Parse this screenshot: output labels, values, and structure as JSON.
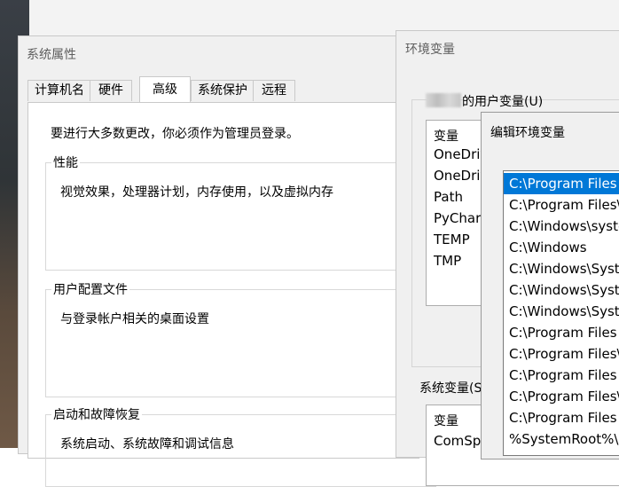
{
  "system_properties": {
    "title": "系统属性",
    "tabs": [
      {
        "label": "计算机名"
      },
      {
        "label": "硬件"
      },
      {
        "label": "高级"
      },
      {
        "label": "系统保护"
      },
      {
        "label": "远程"
      }
    ],
    "active_tab": "高级",
    "notice": "要进行大多数更改，你必须作为管理员登录。",
    "groups": [
      {
        "legend": "性能",
        "desc": "视觉效果，处理器计划，内存使用，以及虚拟内存"
      },
      {
        "legend": "用户配置文件",
        "desc": "与登录帐户相关的桌面设置"
      },
      {
        "legend": "启动和故障恢复",
        "desc": "系统启动、系统故障和调试信息"
      }
    ]
  },
  "env_vars": {
    "title": "环境变量",
    "user_section_label": "的用户变量(U)",
    "column_header": "变量",
    "user_vars": [
      "OneDrive",
      "OneDriv",
      "Path",
      "PyCharm",
      "TEMP",
      "TMP"
    ],
    "system_section_label": "系统变量(S",
    "system_column_header": "变量",
    "system_vars": [
      "ComSpe"
    ]
  },
  "edit_env_var": {
    "title": "编辑环境变量",
    "paths": [
      "C:\\Program Files",
      "C:\\Program Files\\",
      "C:\\Windows\\syste",
      "C:\\Windows",
      "C:\\Windows\\Syst",
      "C:\\Windows\\Syst",
      "C:\\Windows\\Syst",
      "C:\\Program Files",
      "C:\\Program Files\\",
      "C:\\Program Files",
      "C:\\Program Files\\",
      "C:\\Program Files",
      "%SystemRoot%\\s"
    ],
    "selected_index": 0,
    "selection_color": "#0078d7"
  }
}
